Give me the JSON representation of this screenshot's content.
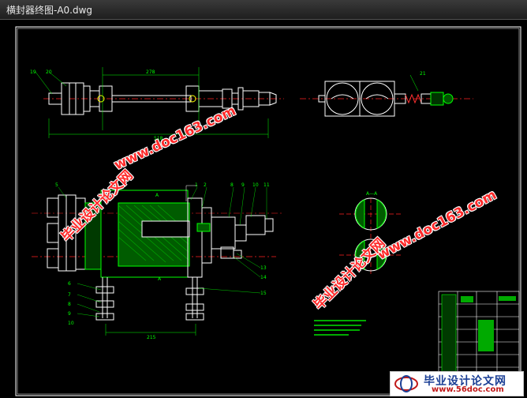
{
  "window": {
    "title": "横封器终图-A0.dwg"
  },
  "drawing": {
    "dims": {
      "top_width": "278",
      "top_total": "518",
      "bottom_width": "215"
    },
    "part_numbers_top": [
      "19",
      "20",
      "21"
    ],
    "part_numbers_mid": [
      "5",
      "4",
      "3",
      "2",
      "1",
      "6",
      "7",
      "8",
      "9",
      "10",
      "11"
    ],
    "part_numbers_left": [
      "6",
      "7",
      "8",
      "9",
      "10"
    ],
    "part_numbers_right": [
      "13",
      "14",
      "15"
    ],
    "section_labels": [
      "A",
      "A",
      "A—A"
    ]
  },
  "watermarks": {
    "url": "www.doc163.com",
    "cn": "毕业设计论文网"
  },
  "logo": {
    "cn": "毕业设计论文网",
    "url": "www.56doc.com"
  },
  "colors": {
    "frame": "#ffffff",
    "part": "#00ff00",
    "centerline": "#ff2020",
    "hatch": "#00ff00"
  }
}
